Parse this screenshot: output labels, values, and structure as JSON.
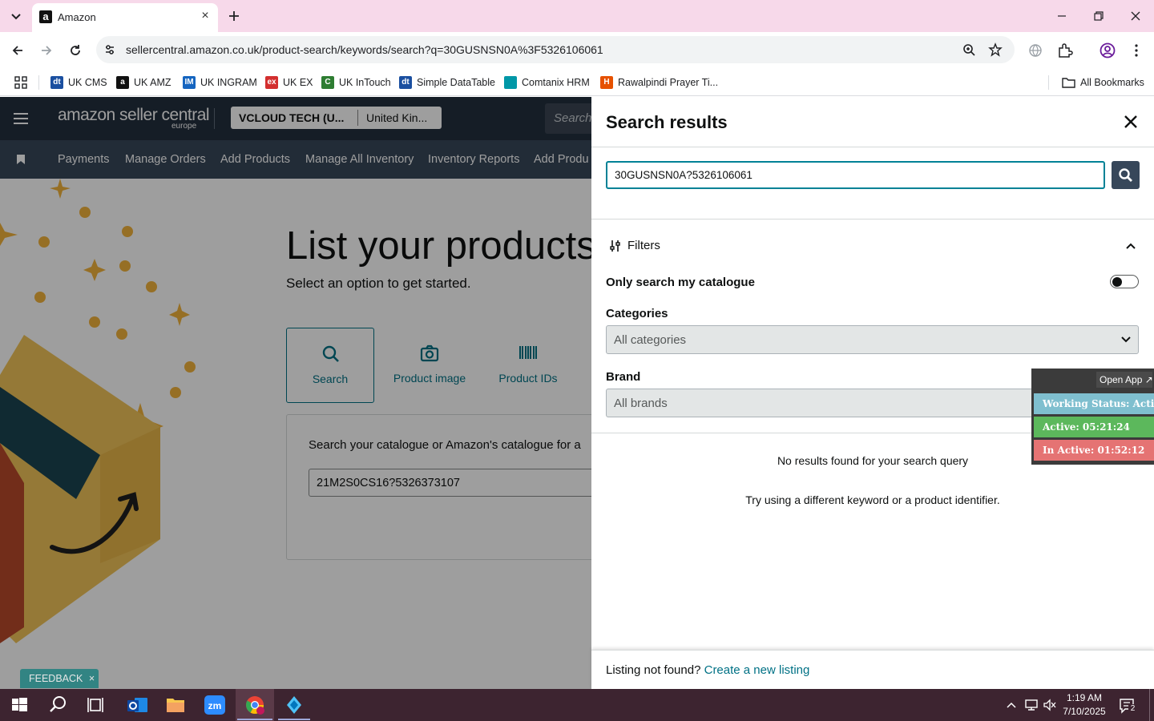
{
  "browser": {
    "tab_title": "Amazon",
    "tab_favicon": "a",
    "url": "sellercentral.amazon.co.uk/product-search/keywords/search?q=30GUSNSN0A%3F5326106061",
    "bookmarks": [
      {
        "label": "UK CMS",
        "icon": "dt-icon",
        "color": "#1a4fa0",
        "glyph": "dt"
      },
      {
        "label": "UK AMZ",
        "icon": "amazon-icon",
        "color": "#111111",
        "glyph": "a"
      },
      {
        "label": "UK INGRAM",
        "icon": "im-icon",
        "color": "#1565c0",
        "glyph": "IM"
      },
      {
        "label": "UK EX",
        "icon": "ex-icon",
        "color": "#d32f2f",
        "glyph": "ex"
      },
      {
        "label": "UK InTouch",
        "icon": "intouch-icon",
        "color": "#2e7d32",
        "glyph": "C"
      },
      {
        "label": "Simple DataTable",
        "icon": "dt-icon",
        "color": "#1a4fa0",
        "glyph": "dt"
      },
      {
        "label": "Comtanix HRM",
        "icon": "comtanix-icon",
        "color": "#0097a7",
        "glyph": ""
      },
      {
        "label": "Rawalpindi Prayer Ti...",
        "icon": "prayer-icon",
        "color": "#e65100",
        "glyph": "H"
      }
    ],
    "all_bookmarks": "All Bookmarks"
  },
  "seller": {
    "logo_text": "amazon seller central",
    "logo_sub": "europe",
    "account": "VCLOUD TECH (U...",
    "marketplace": "United Kin...",
    "search_placeholder": "Search",
    "nav": [
      "Payments",
      "Manage Orders",
      "Add Products",
      "Manage All Inventory",
      "Inventory Reports",
      "Add Produ"
    ]
  },
  "main": {
    "heading": "List your products",
    "subheading": "Select an option to get started.",
    "options": [
      {
        "label": "Search",
        "icon": "search-icon"
      },
      {
        "label": "Product image",
        "icon": "camera-icon"
      },
      {
        "label": "Product IDs",
        "icon": "barcode-icon"
      }
    ],
    "catalogue_text": "Search your catalogue or Amazon's catalogue for a",
    "catalogue_input": "21M2S0CS16?5326373107"
  },
  "panel": {
    "title": "Search results",
    "query": "30GUSNSN0A?5326106061",
    "filters_label": "Filters",
    "only_my_catalogue": "Only search my catalogue",
    "categories_label": "Categories",
    "categories_value": "All categories",
    "brand_label": "Brand",
    "brand_value": "All brands",
    "no_results": "No results found for your search query",
    "try_again": "Try using a different keyword or a product identifier.",
    "listing_not_found": "Listing not found?",
    "create_listing": "Create a new listing"
  },
  "work_status": {
    "open_app": "Open App ↗",
    "status": "Working Status: Active",
    "active": "Active: 05:21:24",
    "inactive": "In Active: 01:52:12",
    "colors": {
      "status": "#7fbfcf",
      "active": "#5cb85c",
      "inactive": "#e57373"
    }
  },
  "feedback": "FEEDBACK",
  "taskbar": {
    "time": "1:19 AM",
    "date": "7/10/2025",
    "notifications": "2"
  }
}
